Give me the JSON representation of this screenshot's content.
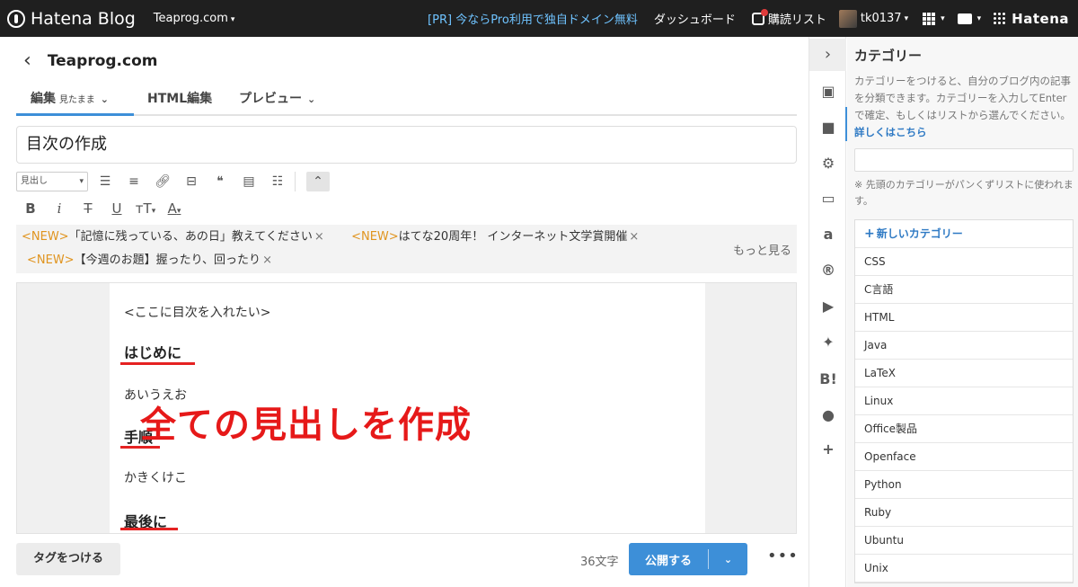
{
  "topbar": {
    "brand": "Hatena Blog",
    "blog_select": "Teaprog.com",
    "promo": "[PR] 今ならPro利用で独自ドメイン無料",
    "dashboard": "ダッシュボード",
    "reading_list": "購読リスト",
    "user": "tk0137",
    "hatena": "Hatena"
  },
  "editor": {
    "blog_title": "Teaprog.com",
    "tabs": {
      "edit": "編集",
      "edit_sub": "見たまま",
      "html": "HTML編集",
      "preview": "プレビュー"
    },
    "title_value": "目次の作成",
    "heading_select": "見出し",
    "notices": [
      {
        "tag": "<NEW>",
        "text": "「記憶に残っている、あの日」教えてください"
      },
      {
        "tag": "<NEW>",
        "text": "はてな20周年！ インターネット文学賞開催"
      },
      {
        "tag": "<NEW>",
        "text": "【今週のお題】握ったり、回ったり"
      }
    ],
    "notice_close": "×",
    "notice_more": "もっと見る",
    "body": {
      "placeholder_line": "<ここに目次を入れたい>",
      "heading1": "はじめに",
      "para1": "あいうえお",
      "heading2": "手順",
      "para2": "かきくけこ",
      "heading3": "最後に"
    },
    "annotation": "全ての見出しを作成",
    "tag_button": "タグをつける",
    "char_count": "36文字",
    "publish": "公開する"
  },
  "category_panel": {
    "title": "カテゴリー",
    "desc": "カテゴリーをつけると、自分のブログ内の記事を分類できます。カテゴリーを入力してEnterで確定、もしくはリストから選んでください。",
    "desc_link": "詳しくはこちら",
    "note": "※ 先頭のカテゴリーがパンくずリストに使われます。",
    "new_category": "新しいカテゴリー",
    "items": [
      "CSS",
      "C言語",
      "HTML",
      "Java",
      "LaTeX",
      "Linux",
      "Office製品",
      "Openface",
      "Python",
      "Ruby",
      "Ubuntu",
      "Unix"
    ]
  },
  "colors": {
    "accent": "#3d8fd8",
    "annotation": "#e61919",
    "new_tag": "#e0941f",
    "topbar": "#1f1f1f"
  }
}
